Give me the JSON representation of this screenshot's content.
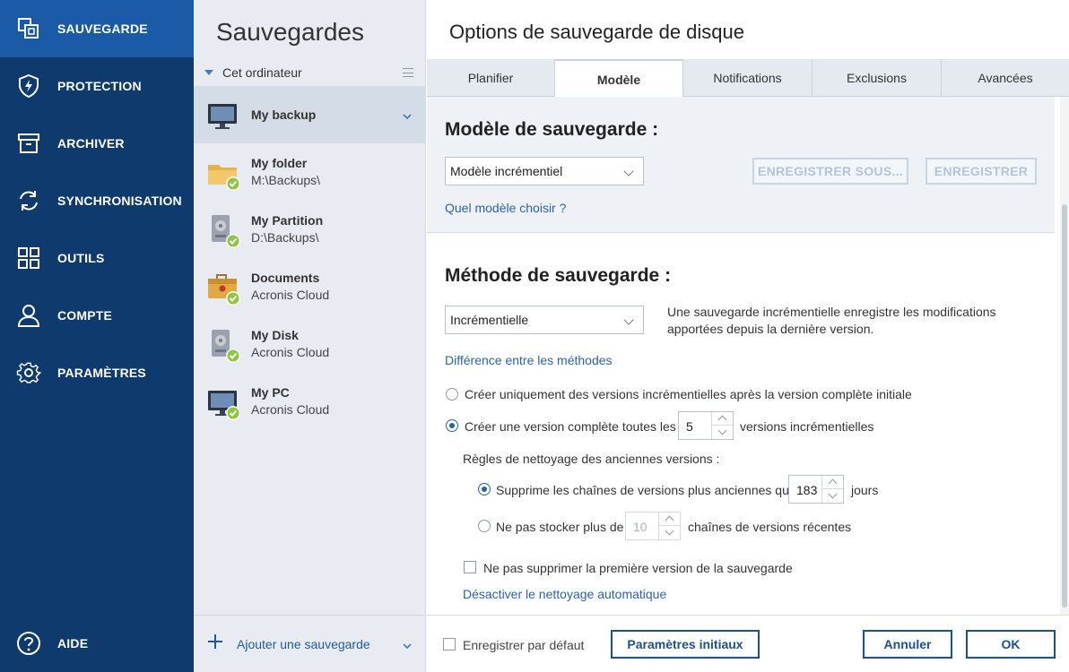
{
  "nav": {
    "items": [
      {
        "label": "SAUVEGARDE",
        "icon": "copy-icon"
      },
      {
        "label": "PROTECTION",
        "icon": "shield-bolt-icon"
      },
      {
        "label": "ARCHIVER",
        "icon": "archive-box-icon"
      },
      {
        "label": "SYNCHRONISATION",
        "icon": "sync-icon"
      },
      {
        "label": "OUTILS",
        "icon": "grid-icon"
      },
      {
        "label": "COMPTE",
        "icon": "user-icon"
      },
      {
        "label": "PARAMÈTRES",
        "icon": "gear-icon"
      }
    ],
    "help_label": "AIDE",
    "active_color": "#1b5aa6",
    "background": "#0e3a6e"
  },
  "backups": {
    "title": "Sauvegardes",
    "section_label": "Cet ordinateur",
    "items": [
      {
        "name": "My backup",
        "dest": "",
        "icon": "monitor-icon"
      },
      {
        "name": "My folder",
        "dest": "M:\\Backups\\",
        "icon": "folder-icon"
      },
      {
        "name": "My Partition",
        "dest": "D:\\Backups\\",
        "icon": "hard-disk-icon"
      },
      {
        "name": "Documents",
        "dest": "Acronis Cloud",
        "icon": "briefcase-icon"
      },
      {
        "name": "My Disk",
        "dest": "Acronis Cloud",
        "icon": "hard-disk-icon"
      },
      {
        "name": "My PC",
        "dest": "Acronis Cloud",
        "icon": "monitor-icon"
      }
    ],
    "add_label": "Ajouter une sauvegarde"
  },
  "options": {
    "title": "Options de sauvegarde de disque",
    "tabs": [
      "Planifier",
      "Modèle",
      "Notifications",
      "Exclusions",
      "Avancées"
    ],
    "active_tab": "Modèle",
    "scheme": {
      "heading": "Modèle de sauvegarde :",
      "selected": "Modèle incrémentiel",
      "save_as_label": "ENREGISTRER SOUS...",
      "save_label": "ENREGISTRER",
      "help_link": "Quel modèle choisir ?"
    },
    "method": {
      "heading": "Méthode de sauvegarde :",
      "selected": "Incrémentielle",
      "description": "Une sauvegarde incrémentielle enregistre les modifications apportées depuis la dernière version.",
      "diff_link": "Différence entre les méthodes",
      "radio1_label": "Créer uniquement des versions incrémentielles après la version complète initiale",
      "radio2_label_pre": "Créer une version complète toutes les",
      "radio2_value": "5",
      "radio2_label_post": "versions incrémentielles",
      "cleanup_heading": "Règles de nettoyage des anciennes versions :",
      "cleanup1_pre": "Supprime les chaînes de versions plus anciennes que",
      "cleanup1_value": "183",
      "cleanup1_post": "jours",
      "cleanup2_pre": "Ne pas stocker plus de",
      "cleanup2_value": "10",
      "cleanup2_post": "chaînes de versions récentes",
      "keep_first_label": "Ne pas supprimer la première version de la sauvegarde",
      "disable_cleanup_link": "Désactiver le nettoyage automatique"
    },
    "footer": {
      "save_default_label": "Enregistrer par défaut",
      "reset_label": "Paramètres initiaux",
      "cancel_label": "Annuler",
      "ok_label": "OK"
    }
  }
}
